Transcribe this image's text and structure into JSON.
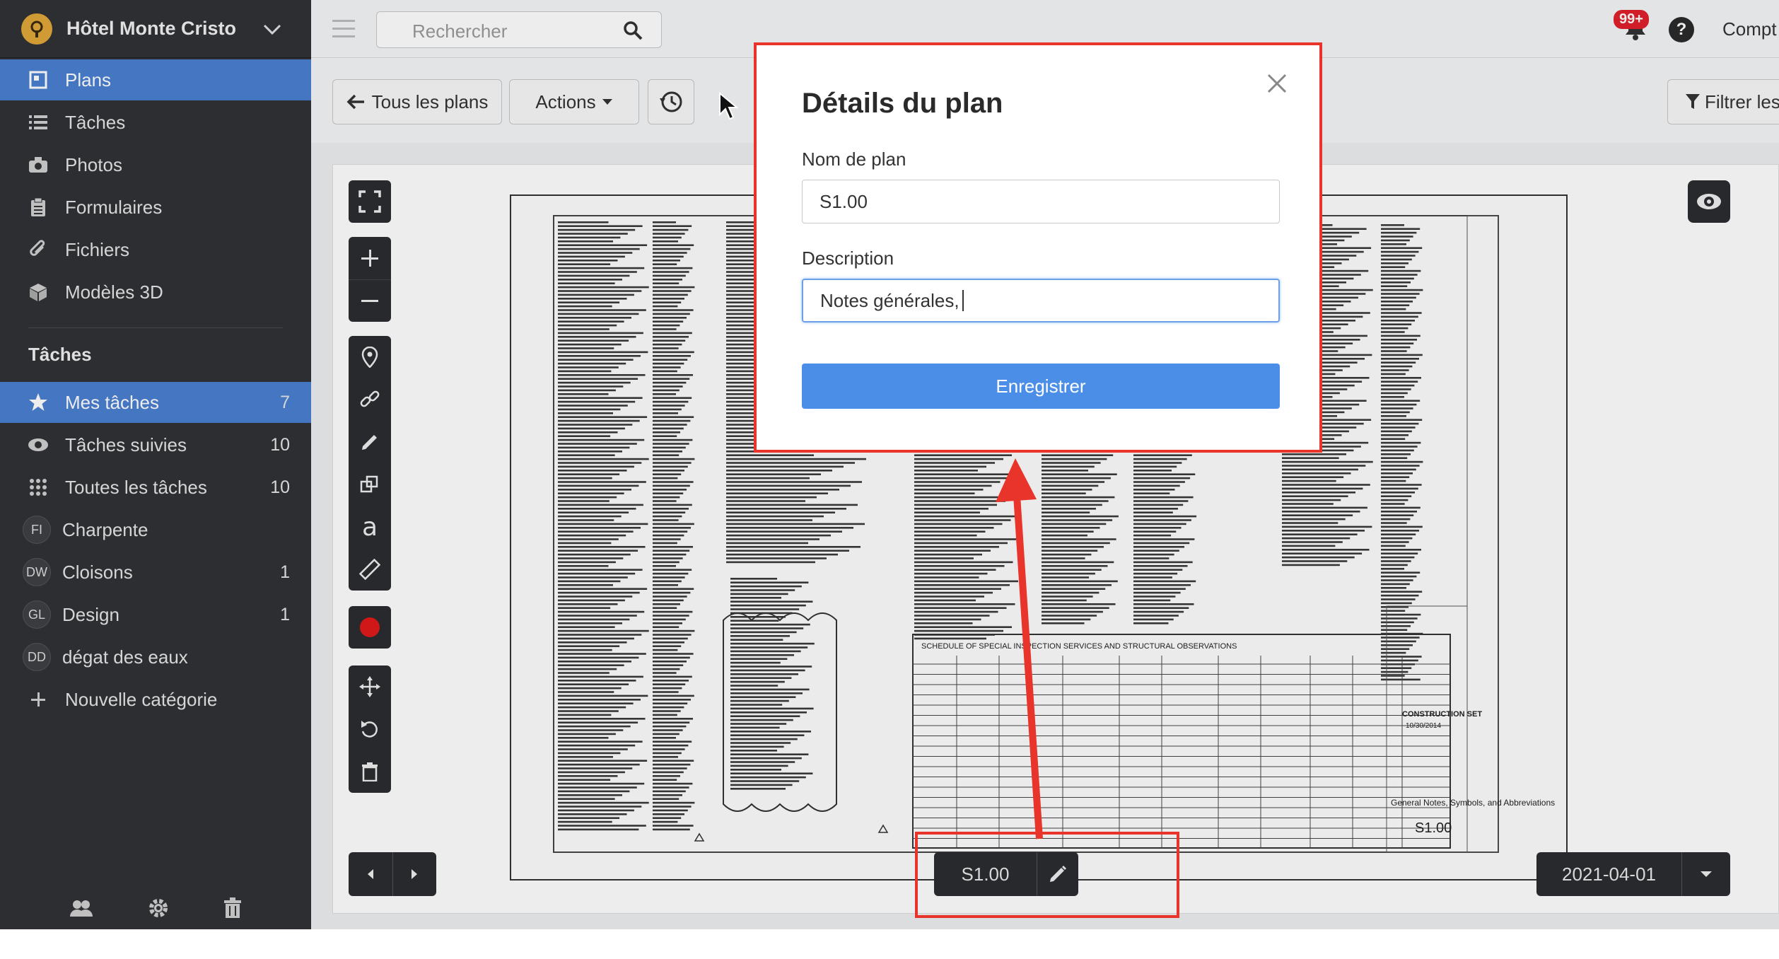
{
  "sidebar": {
    "project_title": "Hôtel Monte Cristo",
    "items": [
      {
        "label": "Plans",
        "icon": "plans-icon"
      },
      {
        "label": "Tâches",
        "icon": "list-icon"
      },
      {
        "label": "Photos",
        "icon": "camera-icon"
      },
      {
        "label": "Formulaires",
        "icon": "clipboard-icon"
      },
      {
        "label": "Fichiers",
        "icon": "paperclip-icon"
      },
      {
        "label": "Modèles 3D",
        "icon": "cube-icon"
      }
    ],
    "tasks_section_title": "Tâches",
    "task_items": [
      {
        "label": "Mes tâches",
        "count": "7",
        "icon": "star-icon"
      },
      {
        "label": "Tâches suivies",
        "count": "10",
        "icon": "eye-icon"
      },
      {
        "label": "Toutes les tâches",
        "count": "10",
        "icon": "grid-icon"
      },
      {
        "label": "Charpente",
        "count": "",
        "badge": "FI"
      },
      {
        "label": "Cloisons",
        "count": "1",
        "badge": "DW"
      },
      {
        "label": "Design",
        "count": "1",
        "badge": "GL"
      },
      {
        "label": "dégat des eaux",
        "count": "",
        "badge": "DD"
      },
      {
        "label": "Nouvelle catégorie",
        "count": "",
        "icon": "plus-icon"
      }
    ]
  },
  "topbar": {
    "search_placeholder": "Rechercher",
    "notification_count": "99+",
    "help_label": "?",
    "account_label": "Compt"
  },
  "toolbar": {
    "back_label": "Tous les plans",
    "actions_label": "Actions",
    "filter_label": "Filtrer les"
  },
  "viewer": {
    "plan_name": "S1.00",
    "date": "2021-04-01",
    "sheet_number": "S1.00",
    "sheet_title": "General Notes, Symbols, and Abbreviations",
    "sheet_set": "CONSTRUCTION SET",
    "sheet_date": "10/30/2014",
    "schedule_title": "SCHEDULE OF SPECIAL INSPECTION SERVICES AND STRUCTURAL OBSERVATIONS"
  },
  "modal": {
    "title": "Détails du plan",
    "name_label": "Nom de plan",
    "name_value": "S1.00",
    "description_label": "Description",
    "description_value": "Notes générales,",
    "save_label": "Enregistrer"
  },
  "colors": {
    "sidebar_bg": "#303235",
    "active_blue": "#4a7fd0",
    "save_button": "#4b8ee8",
    "annotation_red": "#e8342a"
  }
}
